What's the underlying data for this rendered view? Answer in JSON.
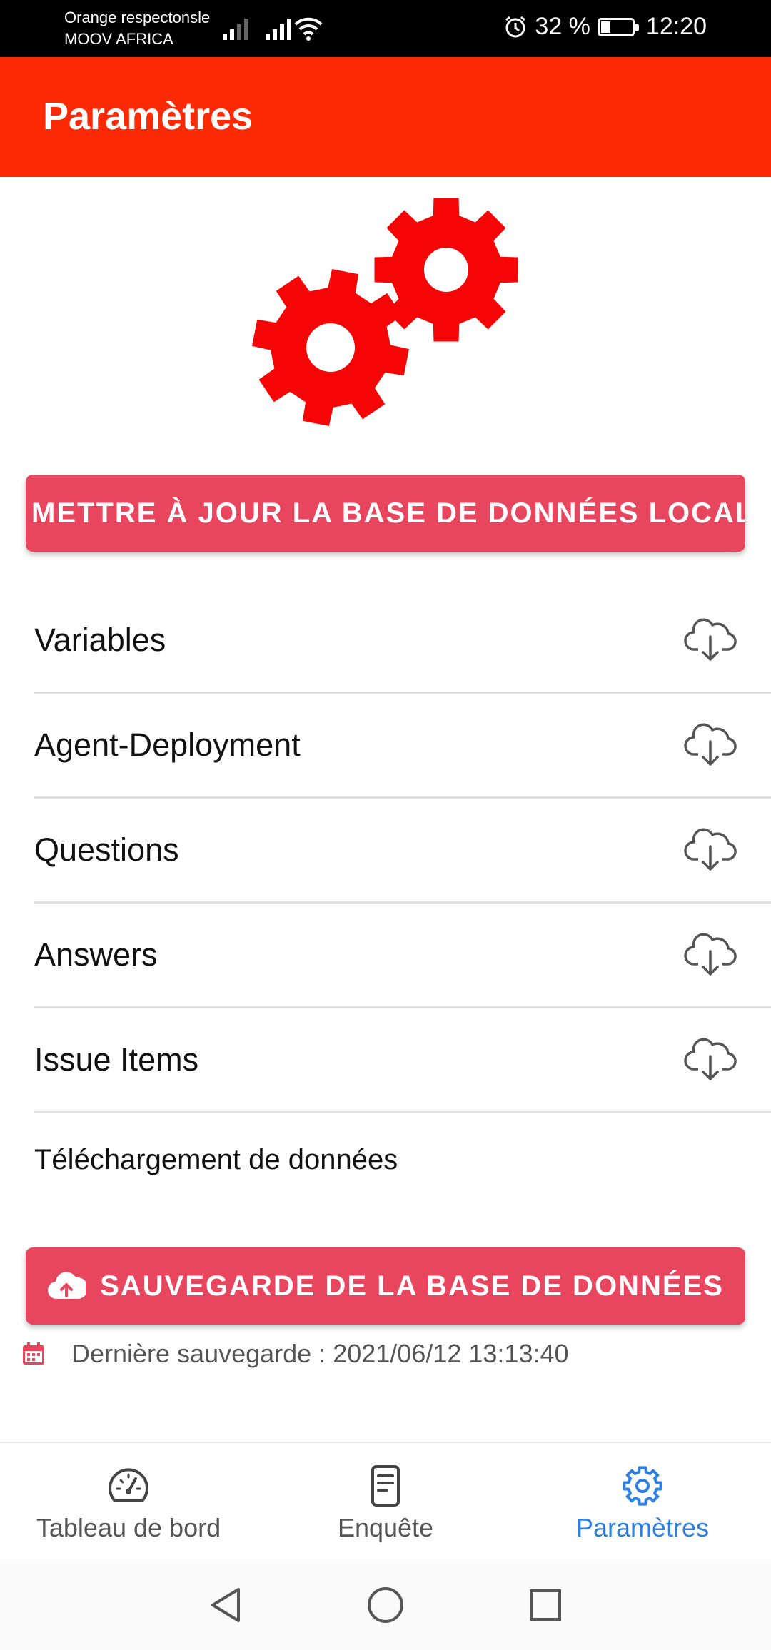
{
  "status_bar": {
    "carrier_line1": "Orange respectonsle",
    "carrier_line2": "MOOV AFRICA",
    "battery_text": "32 %",
    "battery_level": 0.32,
    "time": "12:20"
  },
  "app_bar": {
    "title": "Paramètres"
  },
  "update_button": {
    "label": "METTRE À JOUR LA BASE DE DONNÉES LOCALE"
  },
  "tables": [
    {
      "label": "Variables",
      "icon": "cloud-download-icon"
    },
    {
      "label": "Agent-Deployment",
      "icon": "cloud-download-icon"
    },
    {
      "label": "Questions",
      "icon": "cloud-download-icon"
    },
    {
      "label": "Answers",
      "icon": "cloud-download-icon"
    },
    {
      "label": "Issue Items",
      "icon": "cloud-download-icon"
    }
  ],
  "upload_section": {
    "title": "Téléchargement de données"
  },
  "save_button": {
    "label": "SAUVEGARDE DE LA BASE DE DONNÉES",
    "icon": "cloud-upload-icon"
  },
  "last_save": {
    "text": "Dernière sauvegarde : 2021/06/12 13:13:40",
    "icon": "calendar-icon"
  },
  "bottom_nav": {
    "items": [
      {
        "label": "Tableau de bord",
        "icon": "dashboard-gauge-icon",
        "active": false
      },
      {
        "label": "Enquête",
        "icon": "document-icon",
        "active": false
      },
      {
        "label": "Paramètres",
        "icon": "gear-icon",
        "active": true
      }
    ]
  },
  "colors": {
    "app_bar": "#fb2a05",
    "button": "#e8455e",
    "gear": "#f50505",
    "nav_active": "#2f7fe0"
  }
}
